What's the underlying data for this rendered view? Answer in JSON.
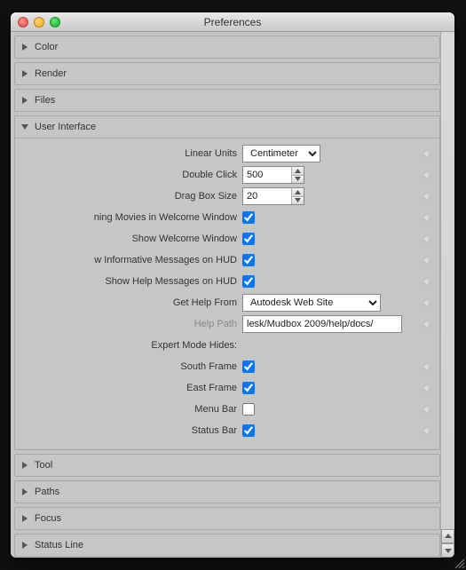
{
  "window": {
    "title": "Preferences"
  },
  "sections": {
    "color": {
      "title": "Color"
    },
    "render": {
      "title": "Render"
    },
    "files": {
      "title": "Files"
    },
    "ui": {
      "title": "User Interface",
      "linear_units_label": "Linear Units",
      "linear_units_value": "Centimeter",
      "double_click_label": "Double Click",
      "double_click_value": "500",
      "drag_box_label": "Drag Box Size",
      "drag_box_value": "20",
      "movies_label": "ning Movies in Welcome Window",
      "movies_checked": true,
      "welcome_label": "Show Welcome Window",
      "welcome_checked": true,
      "hud_info_label": "w Informative Messages on HUD",
      "hud_info_checked": true,
      "hud_help_label": "Show Help Messages on HUD",
      "hud_help_checked": true,
      "get_help_label": "Get Help From",
      "get_help_value": "Autodesk Web Site",
      "help_path_label": "Help Path",
      "help_path_value": "lesk/Mudbox 2009/help/docs/",
      "expert_label": "Expert Mode Hides:",
      "south_label": "South Frame",
      "south_checked": true,
      "east_label": "East Frame",
      "east_checked": true,
      "menubar_label": "Menu Bar",
      "menubar_checked": false,
      "statusbar_label": "Status Bar",
      "statusbar_checked": true
    },
    "tool": {
      "title": "Tool"
    },
    "paths": {
      "title": "Paths"
    },
    "focus": {
      "title": "Focus"
    },
    "statusline": {
      "title": "Status Line"
    }
  }
}
